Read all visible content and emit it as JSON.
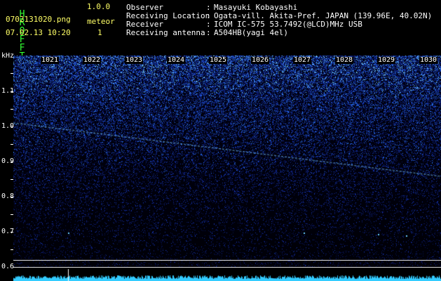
{
  "app": {
    "title_letters": [
      "H",
      "R",
      "O",
      "F",
      "F",
      "T"
    ],
    "version": "1.0.0",
    "filename": "0702131020.png",
    "datetime": "07.02.13 10:20",
    "meteor_label": "meteor",
    "meteor_count": "1"
  },
  "info": [
    {
      "key": "Observer",
      "sep": ":",
      "value": "Masayuki Kobayashi"
    },
    {
      "key": "Receiving Location",
      "sep": ":",
      "value": "Ogata-vill. Akita-Pref. JAPAN (139.96E, 40.02N)"
    },
    {
      "key": "Receiver",
      "sep": ":",
      "value": "ICOM IC-575 53.7492(@LCD)MHz USB"
    },
    {
      "key": "Receiving antenna",
      "sep": ":",
      "value": "A504HB(yagi 4el)"
    }
  ],
  "axis": {
    "unit": "kHz",
    "y_labels": [
      "1.1",
      "1.0",
      "0.9",
      "0.8",
      "0.7",
      "0.6"
    ],
    "minutes": [
      "1021",
      "1022",
      "1023",
      "1024",
      "1025",
      "1026",
      "1027",
      "1028",
      "1029",
      "1030"
    ]
  },
  "colors": {
    "background": "#000000",
    "header_yellow": "#ffff66",
    "header_white": "#ffffff",
    "title_green": "#33ff33",
    "signal_cyan": "#33ccff"
  }
}
